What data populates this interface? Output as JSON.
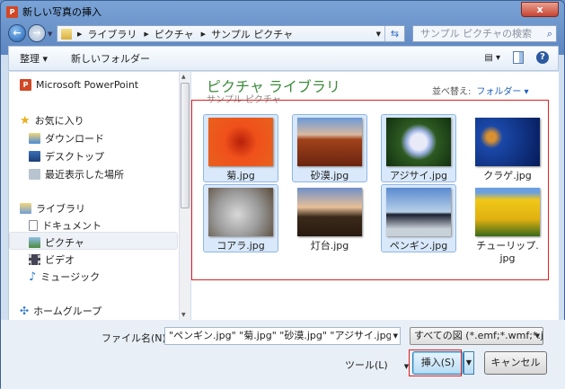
{
  "window": {
    "title": "新しい写真の挿入",
    "close": "x"
  },
  "address": {
    "crumbs": [
      "ライブラリ",
      "ピクチャ",
      "サンプル ピクチャ"
    ],
    "search_placeholder": "サンプル ピクチャの検索"
  },
  "toolbar": {
    "organize": "整理 ▾",
    "new_folder": "新しいフォルダー"
  },
  "sidebar": {
    "app": "Microsoft PowerPoint",
    "favorites": "お気に入り",
    "fav_items": [
      "ダウンロード",
      "デスクトップ",
      "最近表示した場所"
    ],
    "libraries": "ライブラリ",
    "lib_items": [
      "ドキュメント",
      "ピクチャ",
      "ビデオ",
      "ミュージック"
    ],
    "homegroup": "ホームグループ"
  },
  "main": {
    "title": "ピクチャ ライブラリ",
    "subtitle": "サンプル ピクチャ",
    "sort_label": "並べ替え:",
    "sort_value": "フォルダー ▾",
    "files": [
      {
        "name": "菊.jpg",
        "selected": true
      },
      {
        "name": "砂漠.jpg",
        "selected": true
      },
      {
        "name": "アジサイ.jpg",
        "selected": true
      },
      {
        "name": "クラゲ.jpg",
        "selected": false
      },
      {
        "name": "コアラ.jpg",
        "selected": true
      },
      {
        "name": "灯台.jpg",
        "selected": false
      },
      {
        "name": "ペンギン.jpg",
        "selected": true
      },
      {
        "name": "チューリップ.jpg",
        "selected": false
      }
    ]
  },
  "bottom": {
    "filename_label": "ファイル名(N):",
    "filename_value": "\"ペンギン.jpg\" \"菊.jpg\" \"砂漠.jpg\" \"アジサイ.jpg\" \"コアラ.jpg\"",
    "filter": "すべての図 (*.emf;*.wmf;*.j",
    "tools": "ツール(L)",
    "insert": "挿入(S)",
    "cancel": "キャンセル"
  }
}
